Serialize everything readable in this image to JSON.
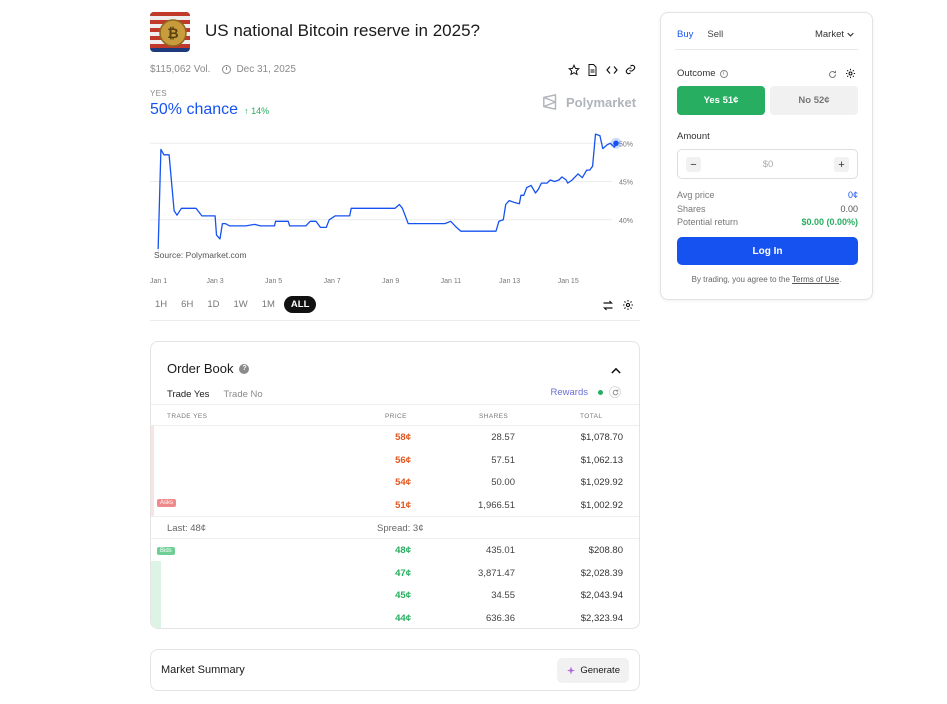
{
  "market": {
    "title": "US national Bitcoin reserve in 2025?",
    "volume": "$115,062 Vol.",
    "end_date": "Dec 31, 2025",
    "outcome_label": "YES",
    "chance_text": "50% chance",
    "change_text": "↑ 14%",
    "brand": "Polymarket"
  },
  "chart_data": {
    "type": "line",
    "title": "",
    "xlabel": "",
    "ylabel": "",
    "x_ticks": [
      "Jan 1",
      "Jan 3",
      "Jan 5",
      "Jan 7",
      "Jan 9",
      "Jan 11",
      "Jan 13",
      "Jan 15"
    ],
    "y_ticks": [
      "40%",
      "45%",
      "50%"
    ],
    "ylim": [
      35,
      52
    ],
    "source_text": "Source: Polymarket.com",
    "series": [
      {
        "color": "#1652f0",
        "points": [
          [
            0.0,
            35.5
          ],
          [
            0.1,
            49.2
          ],
          [
            0.2,
            48.5
          ],
          [
            0.38,
            48.5
          ],
          [
            0.55,
            41.2
          ],
          [
            0.65,
            40.6
          ],
          [
            0.8,
            41.5
          ],
          [
            1.3,
            41.5
          ],
          [
            1.5,
            40.5
          ],
          [
            1.95,
            40.5
          ],
          [
            2.0,
            38.0
          ],
          [
            2.12,
            37.5
          ],
          [
            2.2,
            39.5
          ],
          [
            2.3,
            39.5
          ],
          [
            2.45,
            39.2
          ],
          [
            3.0,
            39.2
          ],
          [
            3.3,
            39.4
          ],
          [
            3.5,
            39.2
          ],
          [
            3.98,
            39.2
          ],
          [
            4.02,
            39.8
          ],
          [
            4.45,
            39.8
          ],
          [
            4.5,
            39.2
          ],
          [
            5.05,
            39.2
          ],
          [
            5.2,
            39.8
          ],
          [
            5.3,
            39.8
          ],
          [
            5.4,
            39.8
          ],
          [
            5.55,
            39.0
          ],
          [
            5.75,
            39.0
          ],
          [
            5.85,
            40.0
          ],
          [
            6.05,
            40.5
          ],
          [
            6.2,
            40.5
          ],
          [
            6.55,
            40.5
          ],
          [
            6.6,
            41.5
          ],
          [
            7.2,
            41.5
          ],
          [
            7.25,
            41.5
          ],
          [
            8.1,
            41.5
          ],
          [
            8.25,
            42.0
          ],
          [
            8.35,
            41.5
          ],
          [
            8.55,
            39.5
          ],
          [
            9.8,
            39.5
          ],
          [
            10.0,
            39.8
          ],
          [
            10.2,
            39.0
          ],
          [
            10.35,
            38.5
          ],
          [
            11.55,
            38.5
          ],
          [
            11.65,
            39.8
          ],
          [
            11.8,
            40.0
          ],
          [
            11.88,
            42.0
          ],
          [
            12.0,
            42.5
          ],
          [
            12.15,
            42.3
          ],
          [
            12.35,
            42.1
          ],
          [
            12.4,
            43.2
          ],
          [
            12.5,
            43.2
          ],
          [
            12.6,
            44.2
          ],
          [
            12.75,
            44.5
          ],
          [
            12.9,
            43.5
          ],
          [
            13.0,
            44.0
          ],
          [
            13.1,
            44.8
          ],
          [
            13.3,
            44.8
          ],
          [
            13.4,
            45.2
          ],
          [
            13.55,
            45.0
          ],
          [
            13.7,
            45.2
          ],
          [
            13.8,
            45.6
          ],
          [
            13.95,
            45.2
          ],
          [
            14.0,
            44.8
          ],
          [
            14.15,
            45.2
          ],
          [
            14.35,
            46.0
          ],
          [
            14.5,
            45.5
          ],
          [
            14.65,
            46.5
          ],
          [
            14.75,
            46.5
          ],
          [
            14.85,
            47.0
          ],
          [
            14.95,
            51.2
          ],
          [
            15.1,
            51.0
          ],
          [
            15.2,
            49.3
          ],
          [
            15.35,
            49.8
          ],
          [
            15.45,
            50.0
          ],
          [
            15.6,
            49.5
          ],
          [
            15.65,
            50.0
          ]
        ]
      }
    ]
  },
  "range": {
    "buttons": [
      "1H",
      "6H",
      "1D",
      "1W",
      "1M",
      "ALL"
    ],
    "active": "ALL"
  },
  "orderbook": {
    "title": "Order Book",
    "tabs": [
      "Trade Yes",
      "Trade No"
    ],
    "active_tab": "Trade Yes",
    "rewards": "Rewards",
    "headers": {
      "side": "TRADE YES",
      "price": "PRICE",
      "shares": "SHARES",
      "total": "TOTAL"
    },
    "asks": [
      {
        "price": "58¢",
        "shares": "28.57",
        "total": "$1,078.70"
      },
      {
        "price": "56¢",
        "shares": "57.51",
        "total": "$1,062.13"
      },
      {
        "price": "54¢",
        "shares": "50.00",
        "total": "$1,029.92"
      },
      {
        "price": "51¢",
        "shares": "1,966.51",
        "total": "$1,002.92"
      }
    ],
    "bids": [
      {
        "price": "48¢",
        "shares": "435.01",
        "total": "$208.80"
      },
      {
        "price": "47¢",
        "shares": "3,871.47",
        "total": "$2,028.39"
      },
      {
        "price": "45¢",
        "shares": "34.55",
        "total": "$2,043.94"
      },
      {
        "price": "44¢",
        "shares": "636.36",
        "total": "$2,323.94"
      }
    ],
    "asks_tag": "Asks",
    "bids_tag": "Bids",
    "last": "Last: 48¢",
    "spread": "Spread: 3¢"
  },
  "summary": {
    "title": "Market Summary",
    "generate": "Generate"
  },
  "trade": {
    "tabs": [
      "Buy",
      "Sell"
    ],
    "active_tab": "Buy",
    "order_type": "Market",
    "outcome_label": "Outcome",
    "yes_button": "Yes 51¢",
    "no_button": "No 52¢",
    "amount_label": "Amount",
    "amount_value": "$0",
    "stats": [
      {
        "label": "Avg price",
        "value": "0¢"
      },
      {
        "label": "Shares",
        "value": "0.00"
      },
      {
        "label": "Potential return",
        "value": "$0.00 (0.00%)"
      }
    ],
    "login": "Log In",
    "terms_prefix": "By trading, you agree to the ",
    "terms_link": "Terms of Use",
    "terms_suffix": "."
  },
  "colors": {
    "accent": "#1652f0",
    "yes": "#27ae60",
    "ask": "#e2571e"
  }
}
